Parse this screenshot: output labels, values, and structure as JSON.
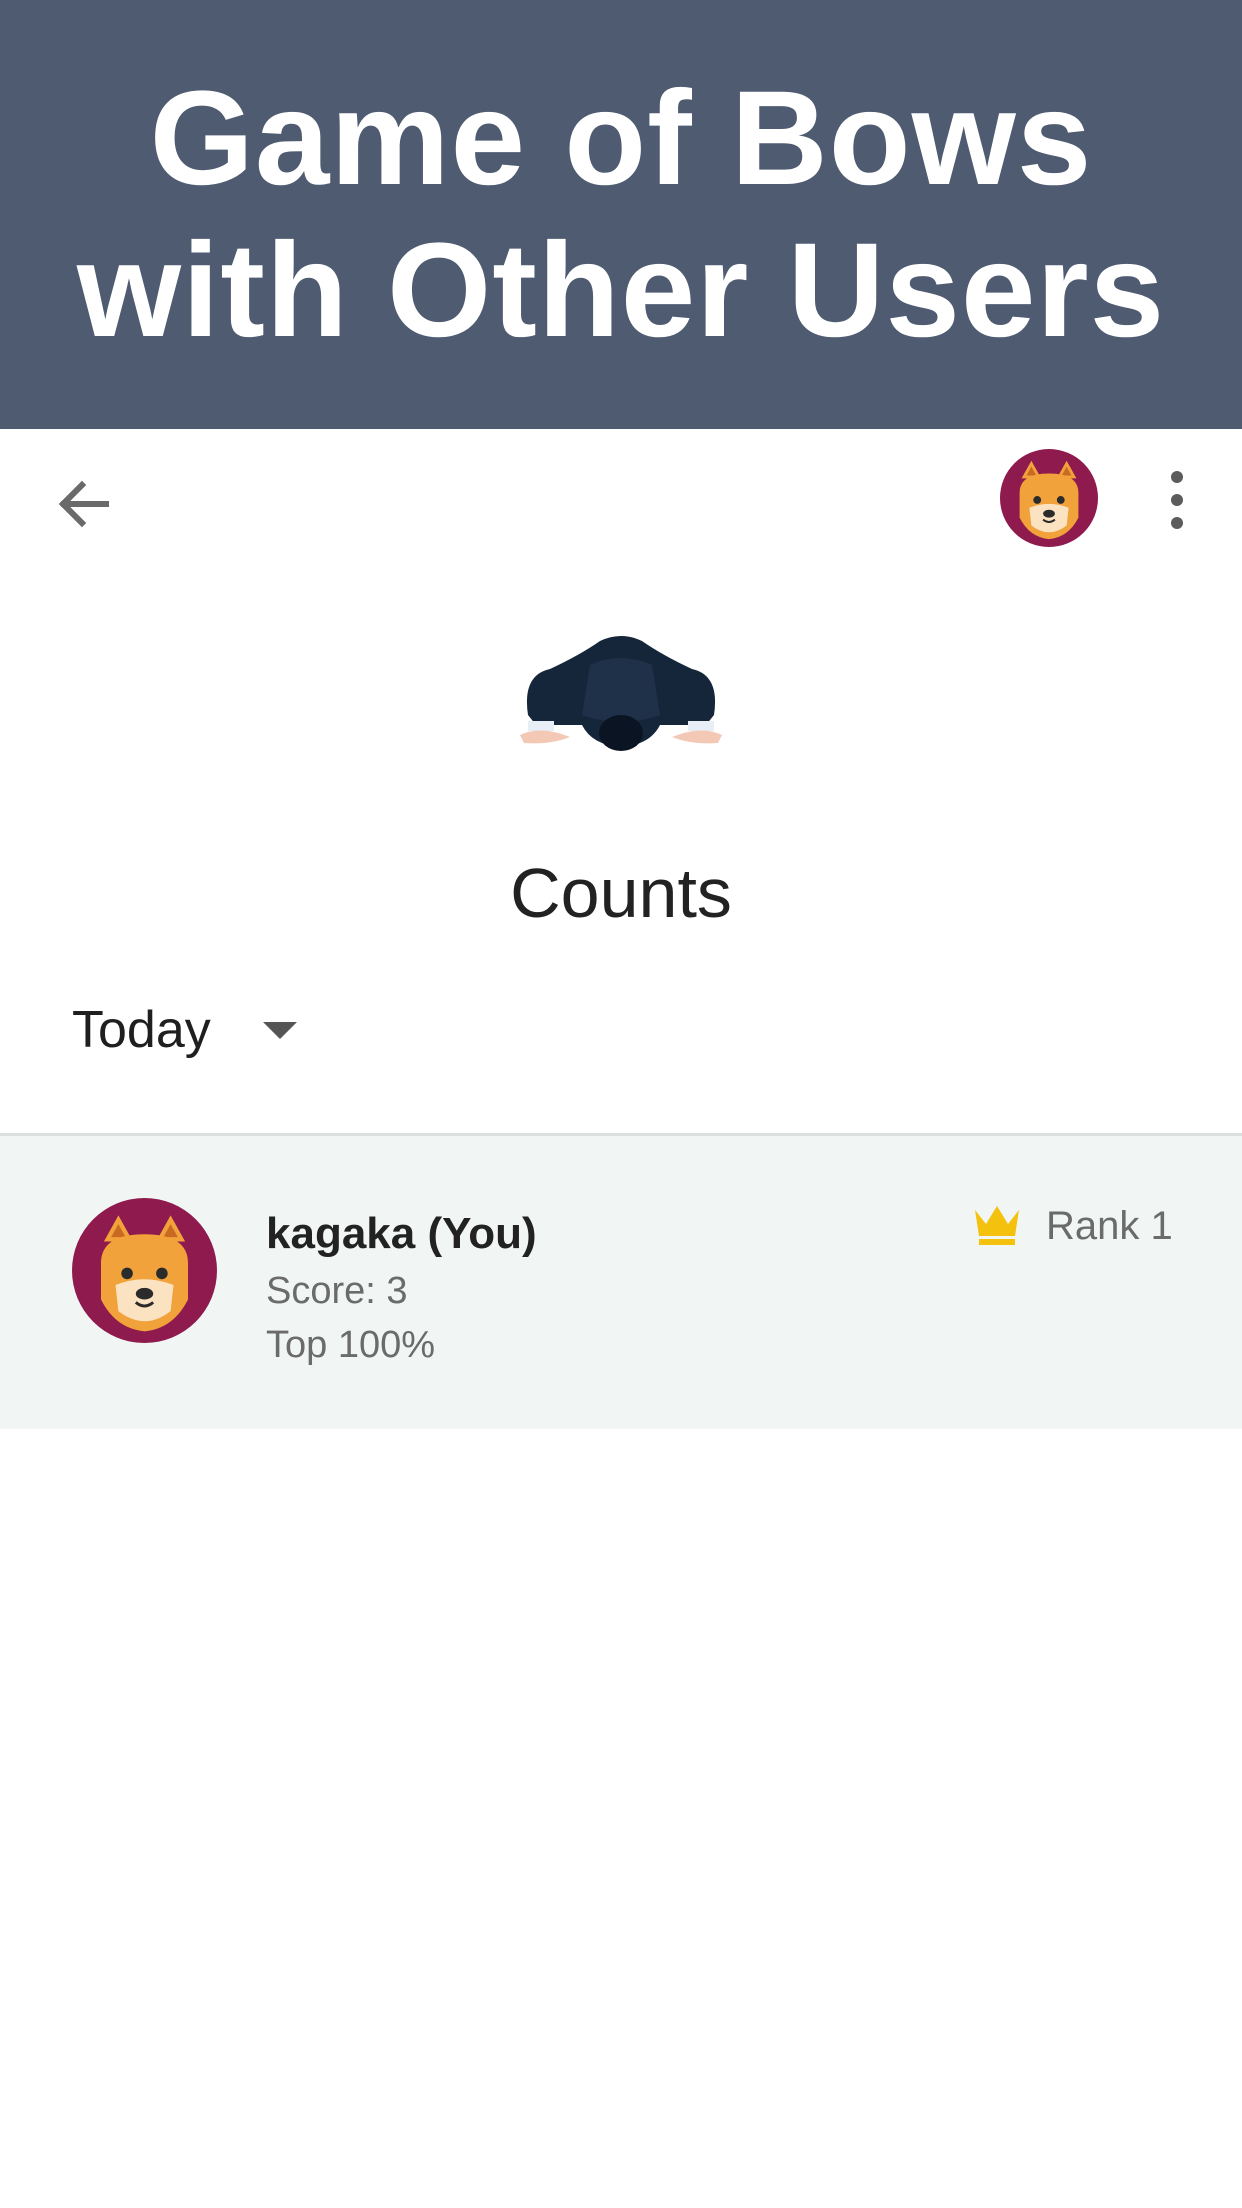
{
  "banner": {
    "line1": "Game of Bows",
    "line2": "with Other Users",
    "color": "#4f5b71"
  },
  "appbar": {
    "back_icon": "arrow-left-icon",
    "avatar_icon": "shiba-dog-avatar",
    "more_icon": "more-vertical-icon"
  },
  "hero": {
    "icon": "bowing-person-illustration"
  },
  "page": {
    "title": "Counts"
  },
  "filter": {
    "selected": "Today",
    "caret_icon": "caret-down-icon"
  },
  "leaderboard": {
    "entries": [
      {
        "name": "kagaka (You)",
        "score": "Score: 3",
        "top": "Top 100%",
        "rank": "Rank 1",
        "rank_icon": "crown-icon",
        "highlight": "#f1f6f5"
      }
    ]
  },
  "colors": {
    "crown": "#f4c10f",
    "avatar_bg": "#8e1a4e",
    "dog": "#f2a23a"
  }
}
